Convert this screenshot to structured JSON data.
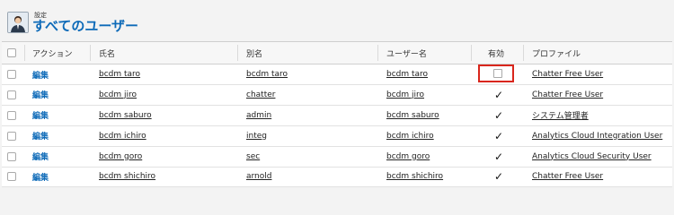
{
  "header": {
    "breadcrumb": "設定",
    "title": "すべてのユーザー"
  },
  "table": {
    "columns": {
      "action": "アクション",
      "name": "氏名",
      "alias": "別名",
      "username": "ユーザー名",
      "active": "有効",
      "profile": "プロファイル"
    },
    "rows": [
      {
        "action": "編集",
        "name": "bcdm taro",
        "alias": "bcdm taro",
        "username": "bcdm taro",
        "active": false,
        "profile": "Chatter Free User"
      },
      {
        "action": "編集",
        "name": "bcdm jiro",
        "alias": "chatter",
        "username": "bcdm jiro",
        "active": true,
        "profile": "Chatter Free User"
      },
      {
        "action": "編集",
        "name": "bcdm saburo",
        "alias": "admin",
        "username": "bcdm saburo",
        "active": true,
        "profile": "システム管理者"
      },
      {
        "action": "編集",
        "name": "bcdm ichiro",
        "alias": "integ",
        "username": "bcdm ichiro",
        "active": true,
        "profile": "Analytics Cloud Integration User"
      },
      {
        "action": "編集",
        "name": "bcdm goro",
        "alias": "sec",
        "username": "bcdm goro",
        "active": true,
        "profile": "Analytics Cloud Security User"
      },
      {
        "action": "編集",
        "name": "bcdm shichiro",
        "alias": "arnold",
        "username": "bcdm shichiro",
        "active": true,
        "profile": "Chatter Free User"
      }
    ]
  },
  "colors": {
    "accent": "#0d6ab8",
    "highlight": "#d9261c"
  },
  "icons": {
    "avatar": "user-avatar-icon",
    "check": "checkmark-icon"
  }
}
